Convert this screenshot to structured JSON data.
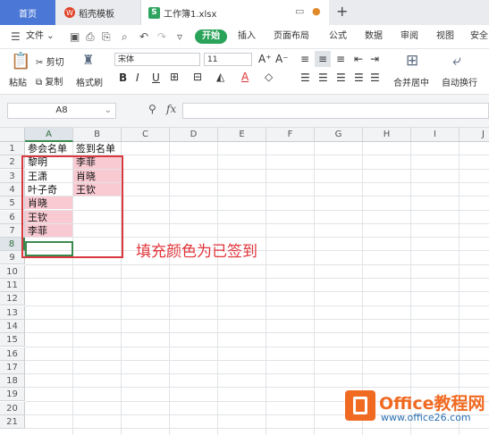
{
  "tabs": {
    "home": "首页",
    "template": "稻壳模板",
    "file": "工作簿1.xlsx",
    "file_icon": "S"
  },
  "menu": {
    "file": "文件",
    "start": "开始",
    "insert": "插入",
    "layout": "页面布局",
    "formula": "公式",
    "data": "数据",
    "review": "审阅",
    "view": "视图",
    "security": "安全"
  },
  "ribbon": {
    "cut": "剪切",
    "paste": "粘贴",
    "copy": "复制",
    "format_painter": "格式刷",
    "font_name": "宋体",
    "font_size": "11",
    "merge": "合并居中",
    "wrap": "自动换行"
  },
  "formula_bar": {
    "name_box": "A8",
    "fx": "fx",
    "value": ""
  },
  "columns": [
    "A",
    "B",
    "C",
    "D",
    "E",
    "F",
    "G",
    "H",
    "I",
    "J"
  ],
  "rows": [
    "1",
    "2",
    "3",
    "4",
    "5",
    "6",
    "7",
    "8",
    "9",
    "10",
    "11",
    "12",
    "13",
    "14",
    "15",
    "16",
    "17",
    "18",
    "19",
    "20",
    "21"
  ],
  "cells": {
    "A1": "参会名单",
    "B1": "签到名单",
    "A2": "黎明",
    "B2": "李菲",
    "A3": "王潇",
    "B3": "肖晓",
    "A4": "叶子奇",
    "B4": "王钦",
    "A5": "肖晓",
    "A6": "王钦",
    "A7": "李菲"
  },
  "annotation": "填充颜色为已签到",
  "watermark": {
    "title": "Office教程网",
    "url": "www.office26.com"
  },
  "colors": {
    "highlight": "#f9cad2",
    "annotation": "#e0343a",
    "start_button": "#2aa35a",
    "selection": "#3a8a4f"
  }
}
